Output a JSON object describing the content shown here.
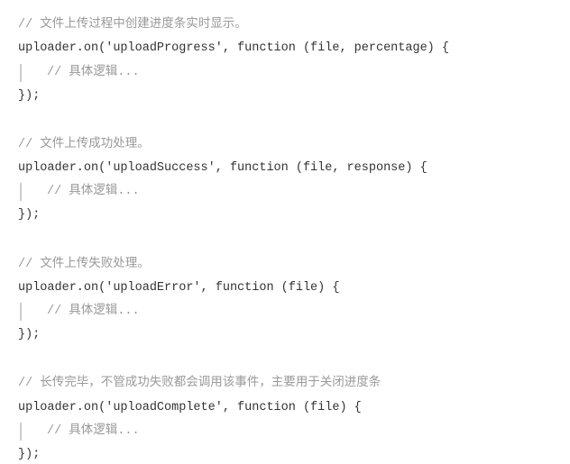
{
  "blocks": [
    {
      "comment": "// 文件上传过程中创建进度条实时显示。",
      "fn_open": "uploader.on('uploadProgress', function (file, percentage) {",
      "body": "// 具体逻辑...",
      "close": "});"
    },
    {
      "comment": "// 文件上传成功处理。",
      "fn_open": "uploader.on('uploadSuccess', function (file, response) {",
      "body": "// 具体逻辑...",
      "close": "});"
    },
    {
      "comment": "// 文件上传失败处理。",
      "fn_open": "uploader.on('uploadError', function (file) {",
      "body": "// 具体逻辑...",
      "close": "});"
    },
    {
      "comment": "// 长传完毕，不管成功失败都会调用该事件，主要用于关闭进度条",
      "fn_open": "uploader.on('uploadComplete', function (file) {",
      "body": "// 具体逻辑...",
      "close": "});"
    }
  ]
}
